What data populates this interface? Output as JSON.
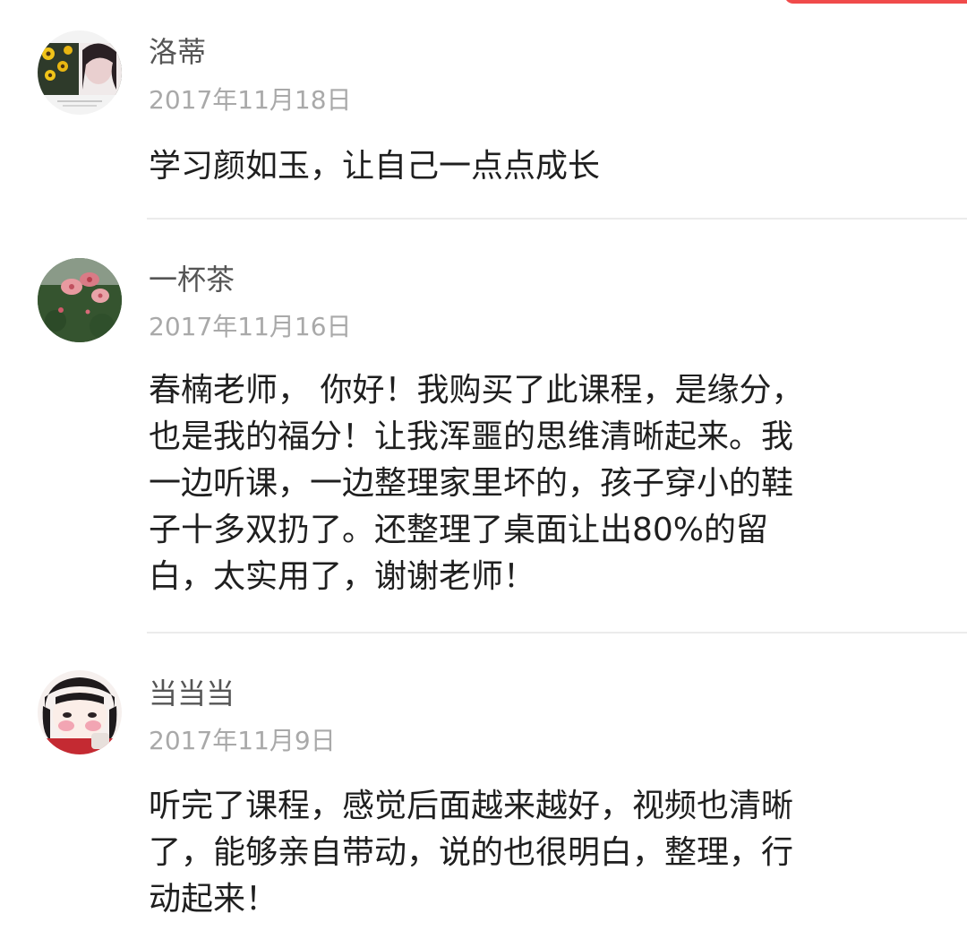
{
  "accent_color": "#f04a4a",
  "comments": [
    {
      "avatar": "avatar-sunflower-girl",
      "username": "洛蒂",
      "date": "2017年11月18日",
      "text": "学习颜如玉，让自己一点点成长"
    },
    {
      "avatar": "avatar-pink-flowers",
      "username": "一杯茶",
      "date": "2017年11月16日",
      "text": "春楠老师，  你好！我购买了此课程，是缘分，\n也是我的福分！让我浑噩的思维清晰起来。我\n一边听课，一边整理家里坏的，孩子穿小的鞋\n子十多双扔了。还整理了桌面让出80%的留\n白，太实用了，谢谢老师！"
    },
    {
      "avatar": "avatar-cartoon-girl",
      "username": "当当当",
      "date": "2017年11月9日",
      "text": "听完了课程，感觉后面越来越好，视频也清晰\n了，能够亲自带动，说的也很明白，整理，行\n动起来！"
    }
  ]
}
